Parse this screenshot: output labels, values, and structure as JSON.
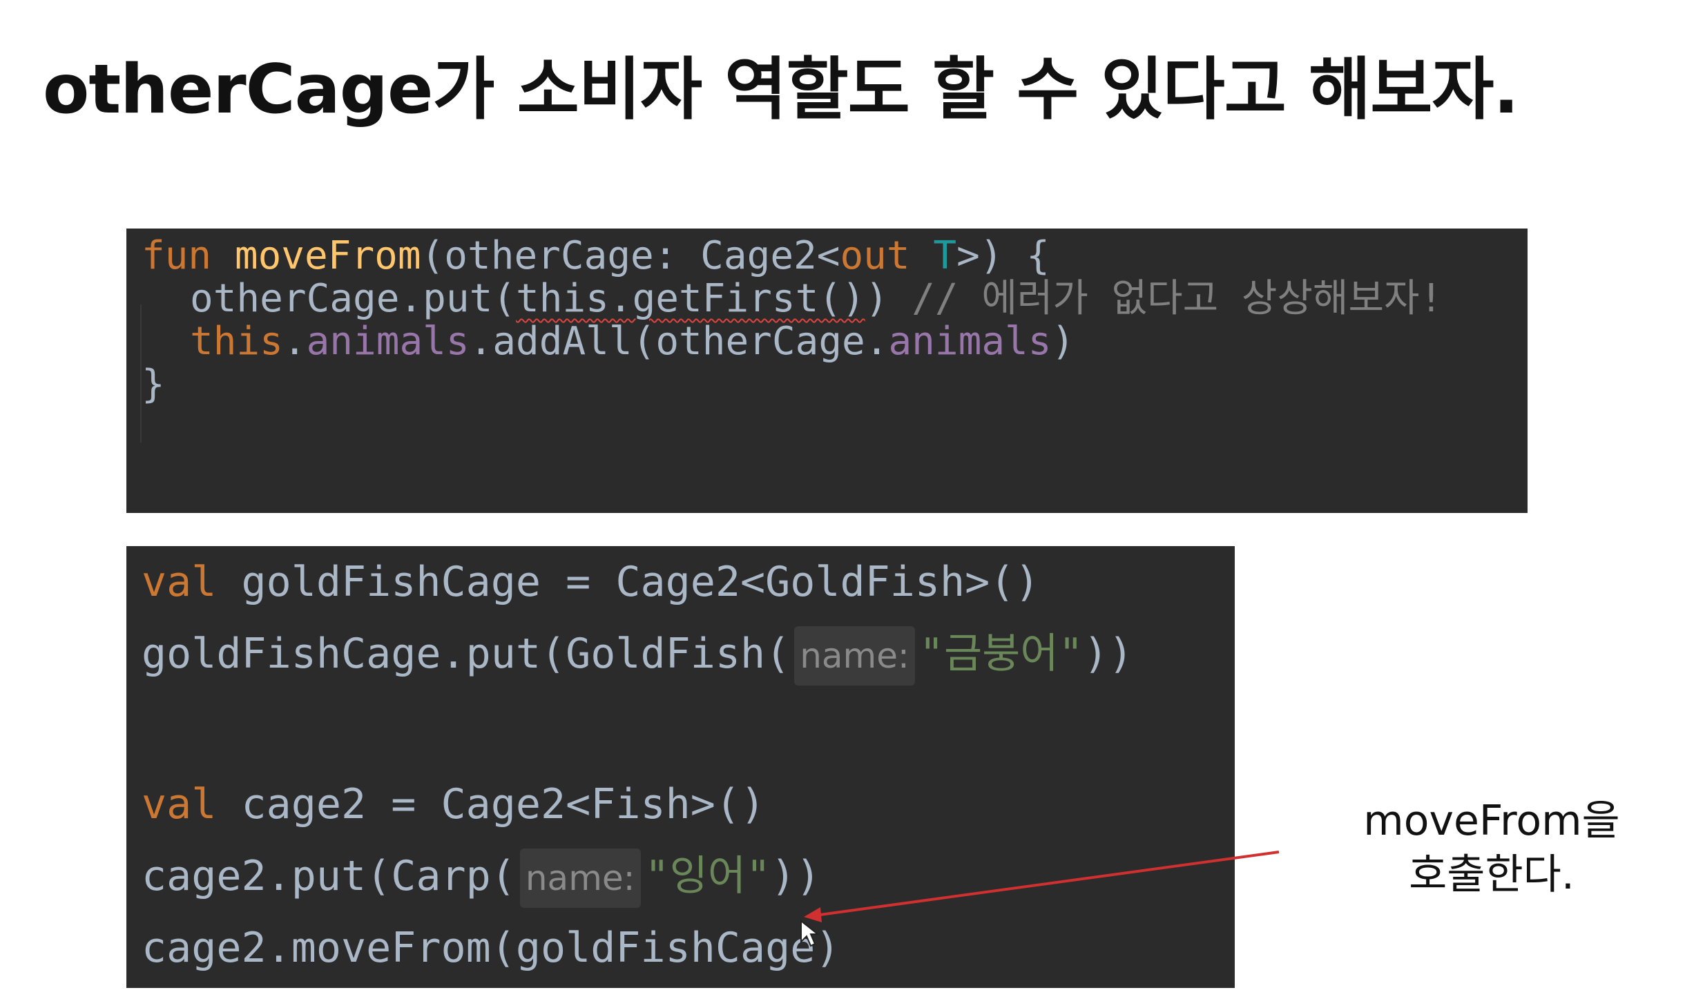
{
  "slide": {
    "title": "otherCage가 소비자 역할도 할 수 있다고 해보자."
  },
  "code_top": {
    "line1": {
      "kw_fun": "fun",
      "fn_name": "moveFrom",
      "params_open": "(otherCage: Cage2<",
      "kw_out": "out",
      "type_param": "T",
      "tail": ">) {"
    },
    "line2": {
      "prefix": "otherCage.put(",
      "squiggled": "this.getFirst()",
      "suffix": ") ",
      "comment": "// 에러가 없다고 상상해보자!"
    },
    "line3": {
      "kw_this": "this",
      "dot1": ".",
      "prop1": "animals",
      "mid": ".addAll(otherCage.",
      "prop2": "animals",
      "close": ")"
    },
    "line4": "}"
  },
  "code_bottom": {
    "line1": {
      "kw_val": "val",
      "text": " goldFishCage = Cage2<GoldFish>()"
    },
    "line2": {
      "prefix": "goldFishCage.put(GoldFish(",
      "hint": "name:",
      "string": "\"금붕어\"",
      "suffix": "))"
    },
    "line3": {
      "kw_val": "val",
      "text": " cage2 = Cage2<Fish>()"
    },
    "line4": {
      "prefix": "cage2.put(Carp(",
      "hint": "name:",
      "string": "\"잉어\"",
      "suffix": "))"
    },
    "line5": "cage2.moveFrom(goldFishCage)"
  },
  "annotation": {
    "line1": "moveFrom을",
    "line2": "호출한다."
  },
  "colors": {
    "editor_bg": "#2b2b2b",
    "keyword": "#cc7832",
    "function": "#ffc66d",
    "type_param": "#20999d",
    "property": "#9876aa",
    "string": "#6a8759",
    "comment": "#808080",
    "arrow": "#d03030"
  }
}
